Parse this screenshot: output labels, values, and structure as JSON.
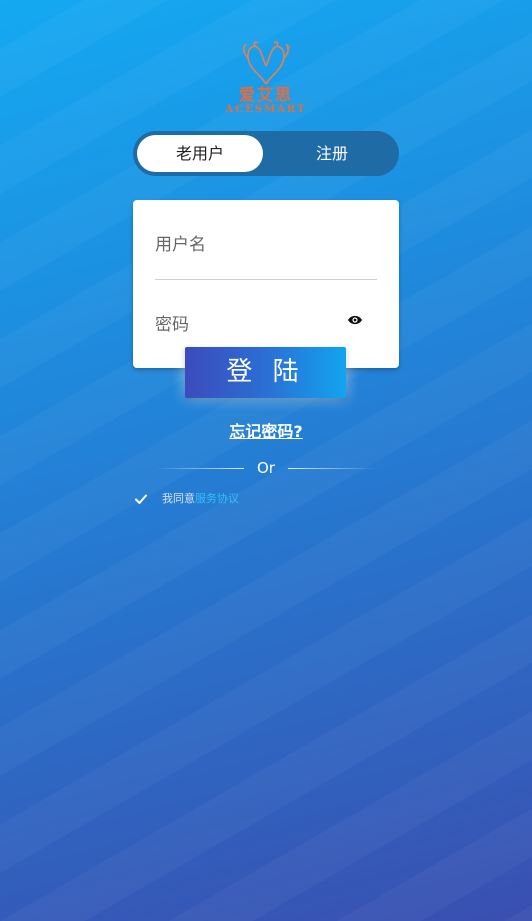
{
  "logo": {
    "name_cn": "爱艾思",
    "name_en": "ACESMART",
    "brand_color": "#e56d3c"
  },
  "tabs": {
    "existing_user": "老用户",
    "register": "注册",
    "active": "existing_user"
  },
  "form": {
    "username_label": "用户名",
    "password_label": "密码",
    "eye_icon": "eye-icon"
  },
  "login_button": "登 陆",
  "forgot_password": "忘记密码?",
  "divider_text": "Or",
  "agreement": {
    "checked": true,
    "prefix": "我同意",
    "link": "服务协议",
    "link_color": "#37c0f5"
  }
}
